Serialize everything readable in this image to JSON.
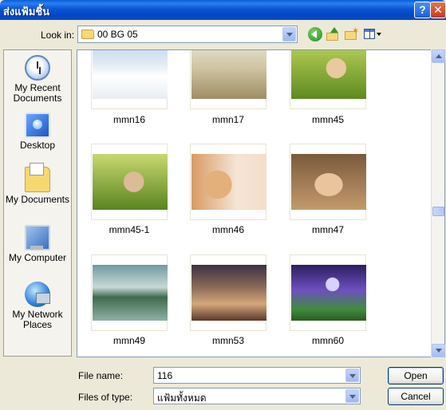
{
  "window": {
    "title": "ส่งแฟ้มชิ้น",
    "help_glyph": "?",
    "close_glyph": "✕"
  },
  "toolbar": {
    "look_in_label": "Look in:",
    "look_in_value": "00 BG 05"
  },
  "places": [
    {
      "label": "My Recent Documents",
      "icon": "recent-documents-icon"
    },
    {
      "label": "Desktop",
      "icon": "desktop-icon"
    },
    {
      "label": "My Documents",
      "icon": "my-documents-icon"
    },
    {
      "label": "My Computer",
      "icon": "my-computer-icon"
    },
    {
      "label": "My Network Places",
      "icon": "network-places-icon"
    }
  ],
  "files": [
    "mmn16",
    "mmn17",
    "mmn45",
    "mmn45-1",
    "mmn46",
    "mmn47",
    "mmn49",
    "mmn53",
    "mmn60"
  ],
  "fields": {
    "file_name_label": "File name:",
    "file_name_value": "116",
    "file_type_label": "Files of type:",
    "file_type_value": "แฟ้มทั้งหมด"
  },
  "buttons": {
    "open": "Open",
    "cancel": "Cancel"
  },
  "colors": {
    "titlebar": "#0a4bc6",
    "dialog_bg": "#ece9d8",
    "close_button": "#c7391b"
  }
}
